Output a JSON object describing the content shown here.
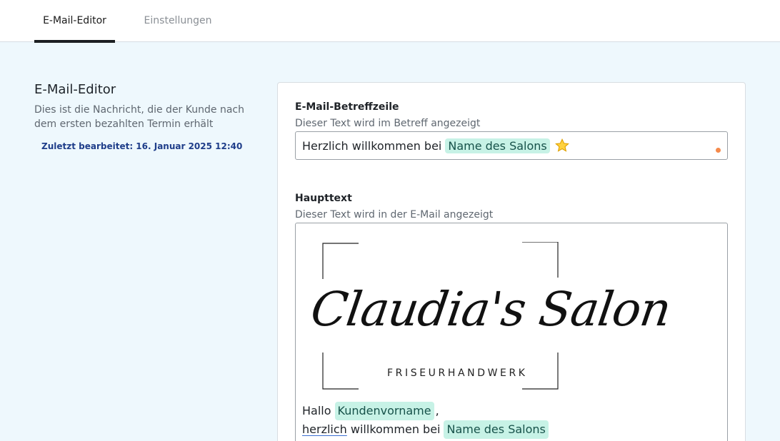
{
  "tabs": [
    {
      "label": "E-Mail-Editor",
      "active": true
    },
    {
      "label": "Einstellungen",
      "active": false
    }
  ],
  "sidebar": {
    "title": "E-Mail-Editor",
    "description": "Dies ist die Nachricht, die der Kunde nach dem ersten bezahlten Termin erhält",
    "last_edited": "Zuletzt bearbeitet: 16. Januar 2025 12:40"
  },
  "subject": {
    "label": "E-Mail-Betreffzeile",
    "help": "Dieser Text wird im Betreff angezeigt",
    "prefix": "Herzlich willkommen bei",
    "chip": "Name des Salons",
    "emoji_icon": "star-icon"
  },
  "body": {
    "label": "Haupttext",
    "help": "Dieser Text wird in der E-Mail angezeigt",
    "logo_script": "Claudia's Salon",
    "logo_subtitle": "FRISEURHANDWERK",
    "line1_prefix": "Hallo",
    "line1_chip": "Kundenvorname",
    "line1_suffix": ",",
    "line2_word_underlined": "herzlich",
    "line2_middle": "willkommen bei",
    "line2_chip": "Name des Salons"
  },
  "colors": {
    "background": "#eef8fd",
    "chip_bg": "#c7f2e6",
    "edited_text": "#1f3e8a",
    "accent_orange": "#f58a4b",
    "error_red": "#e53935"
  }
}
